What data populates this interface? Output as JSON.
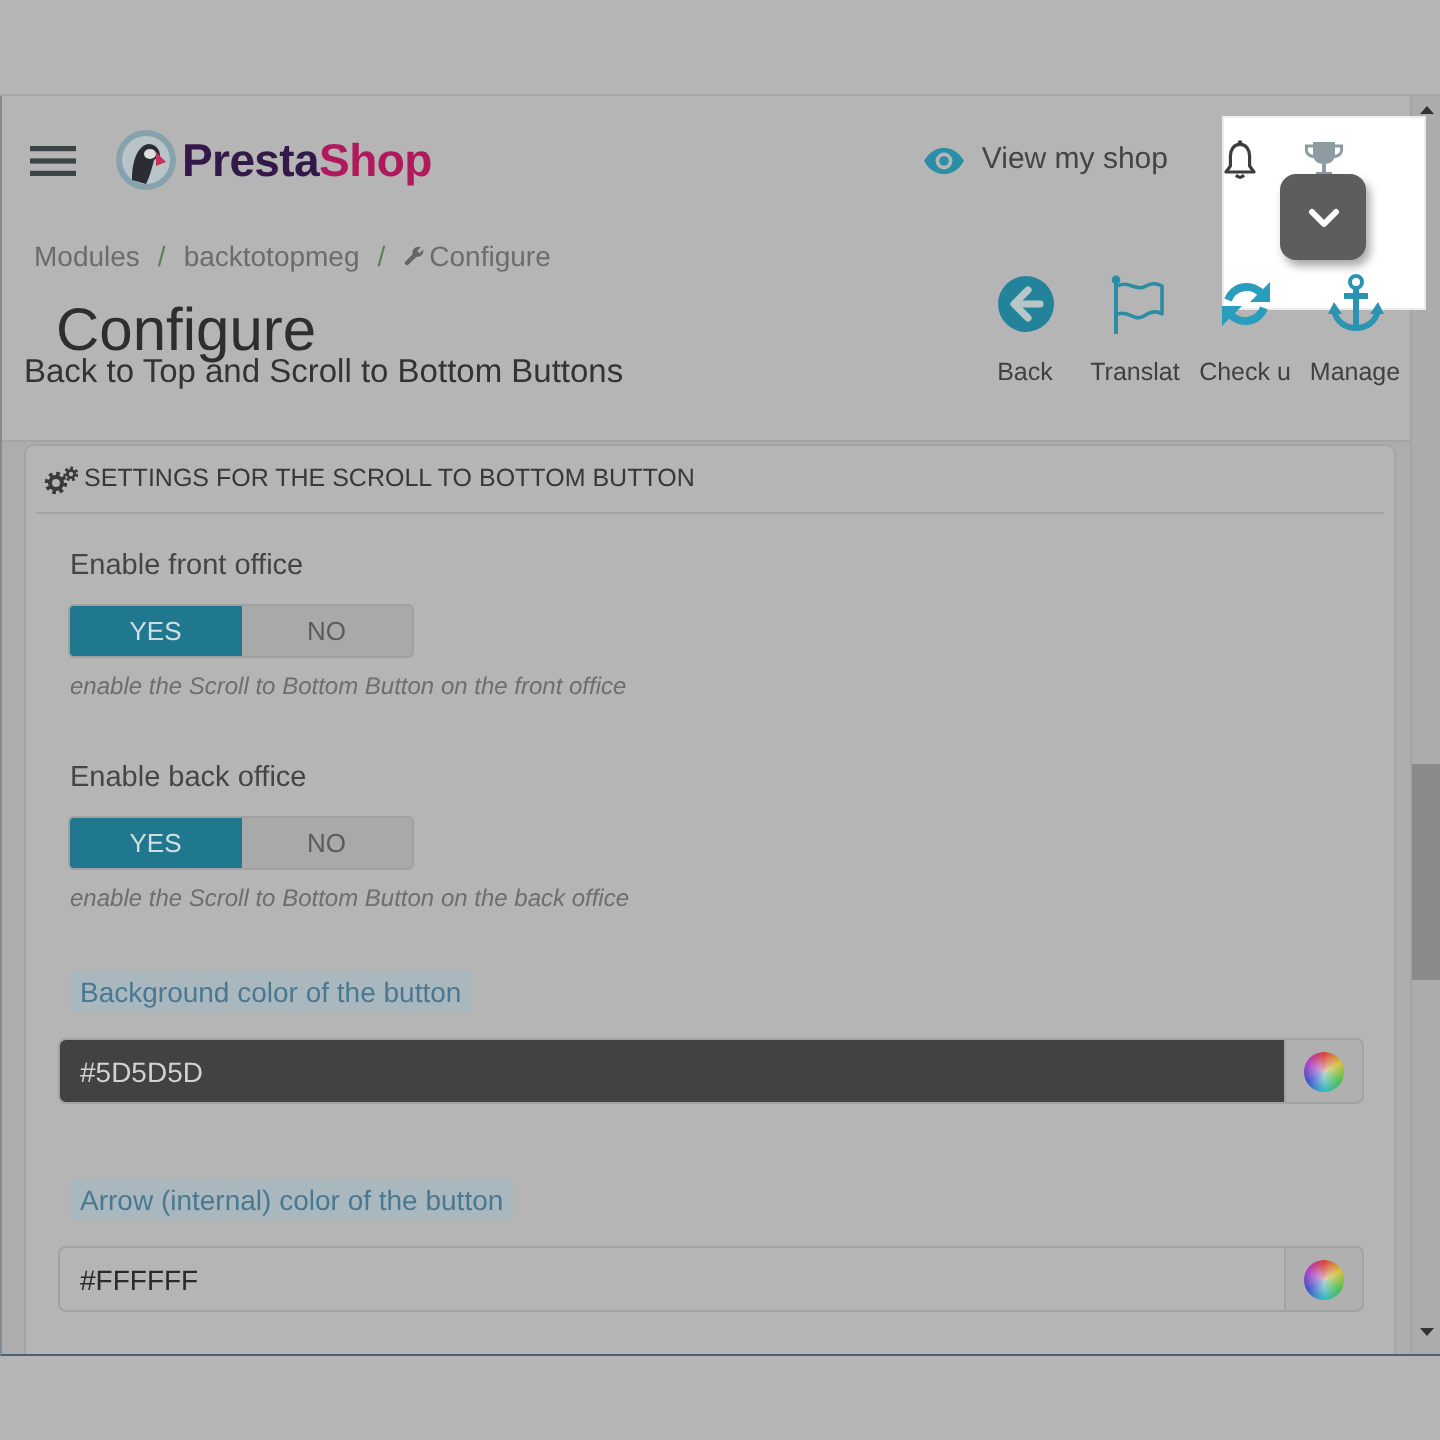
{
  "header": {
    "brand": {
      "parts": [
        {
          "text": "Presta",
          "color": "#34184a"
        },
        {
          "text": "Shop",
          "color": "#b01a5c"
        }
      ]
    },
    "view_shop": "View my shop"
  },
  "breadcrumb": {
    "separator": "/",
    "items": [
      "Modules",
      "backtotopmeg",
      "Configure"
    ]
  },
  "page_head": {
    "title": "Configure",
    "subtitle": "Back to Top and Scroll to Bottom Buttons",
    "toolbar": [
      "Back",
      "Translat",
      "Check u",
      "Manage"
    ]
  },
  "panel": {
    "heading": "SETTINGS FOR THE SCROLL TO BOTTOM BUTTON",
    "fields": [
      {
        "kind": "switch",
        "label": "Enable front office",
        "options": [
          {
            "label": "YES",
            "selected": true
          },
          {
            "label": "NO",
            "selected": false
          }
        ],
        "help": "enable the Scroll to Bottom Button on the front office"
      },
      {
        "kind": "switch",
        "label": "Enable back office",
        "options": [
          {
            "label": "YES",
            "selected": true
          },
          {
            "label": "NO",
            "selected": false
          }
        ],
        "help": "enable the Scroll to Bottom Button on the back office"
      },
      {
        "kind": "color",
        "label": "Background color of the button",
        "value": "#5D5D5D"
      },
      {
        "kind": "color",
        "label": "Arrow (internal) color of the button",
        "value": "#FFFFFF"
      }
    ]
  }
}
